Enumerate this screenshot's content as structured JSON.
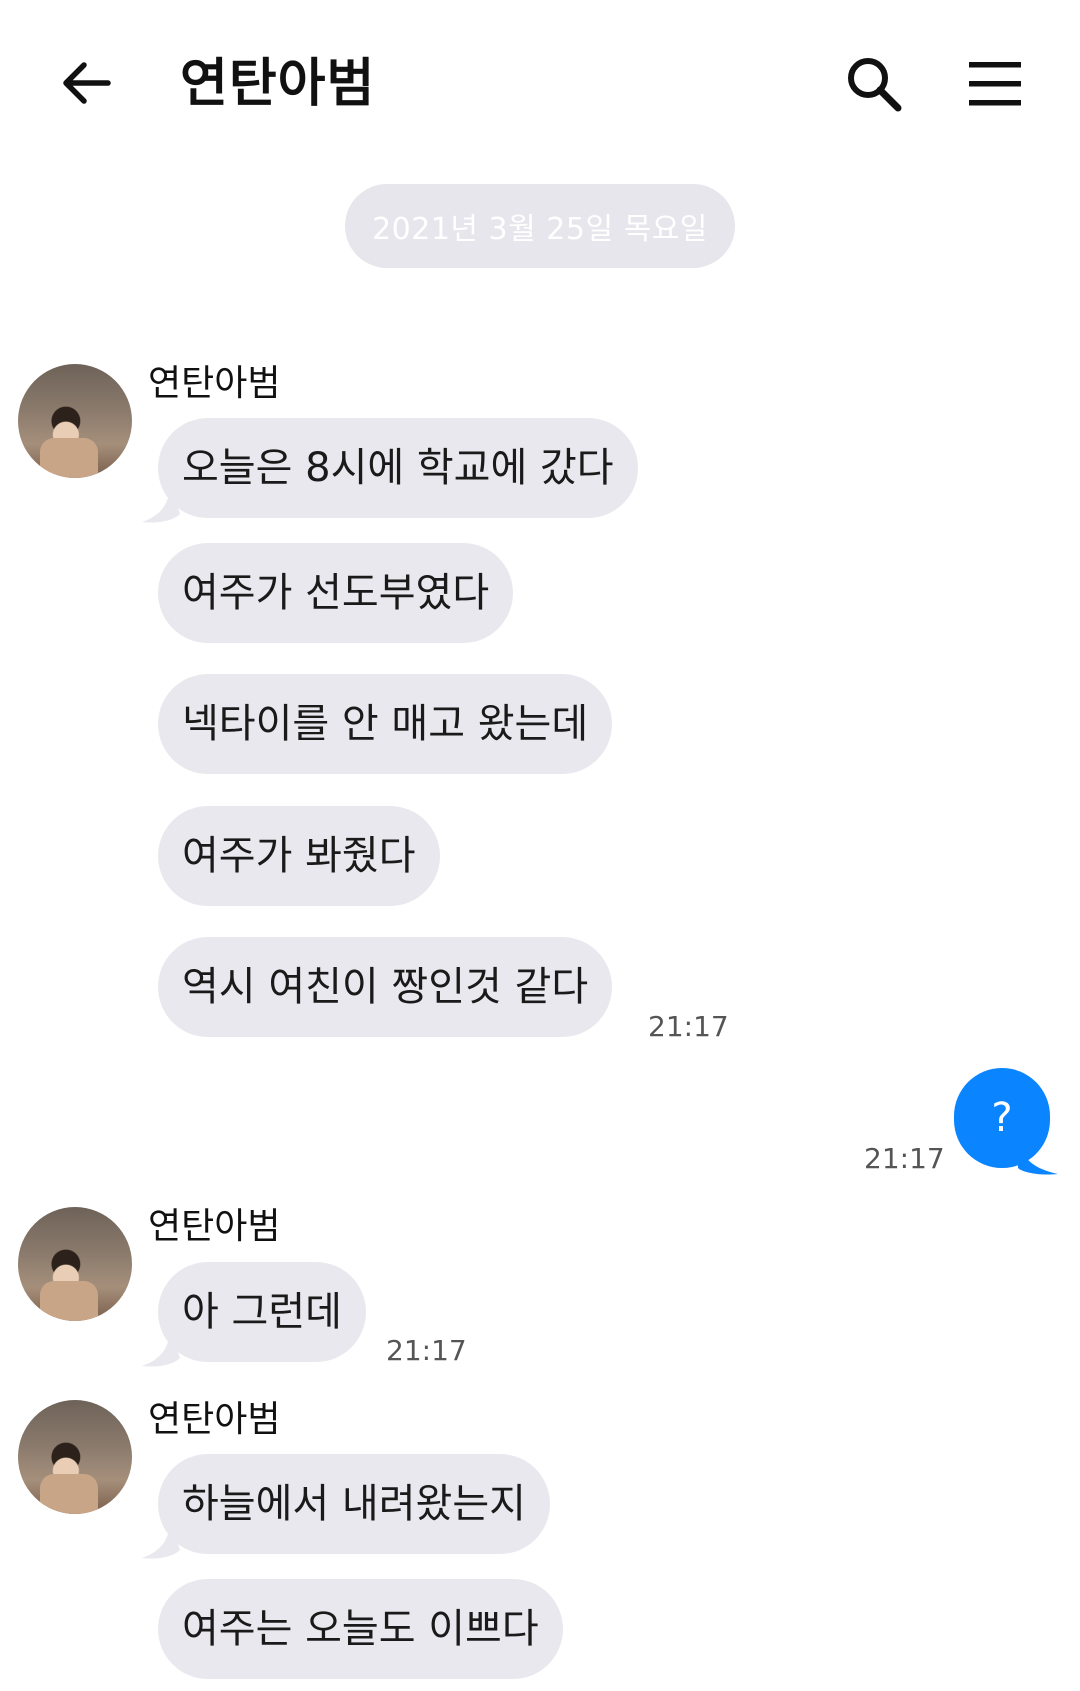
{
  "header": {
    "title": "연탄아범",
    "back_icon": "arrow-left-icon",
    "search_icon": "search-icon",
    "menu_icon": "hamburger-menu-icon"
  },
  "date_separator": "2021년 3월 25일 목요일",
  "colors": {
    "incoming_bubble": "#e8e8ee",
    "outgoing_bubble": "#0a84ff",
    "date_chip": "#e6e6ec"
  },
  "groups": [
    {
      "sender": "연탄아범",
      "messages": [
        "오늘은 8시에 학교에 갔다",
        "여주가 선도부였다",
        "넥타이를 안 매고 왔는데",
        "여주가 봐줬다",
        "역시 여친이 짱인것 같다"
      ],
      "time": "21:17"
    },
    {
      "sender": "연탄아범",
      "messages": [
        "아 그런데"
      ],
      "time": "21:17"
    },
    {
      "sender": "연탄아범",
      "messages": [
        "하늘에서 내려왔는지",
        "여주는 오늘도 이쁘다"
      ],
      "time": ""
    }
  ],
  "outgoing": {
    "text": "?",
    "time": "21:17"
  }
}
